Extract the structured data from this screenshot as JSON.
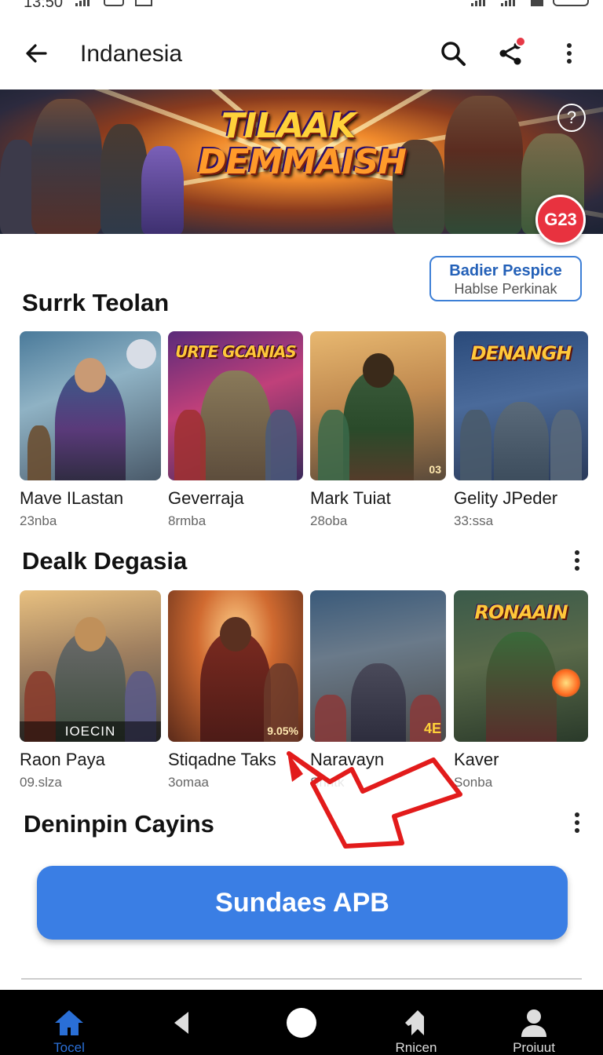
{
  "status": {
    "time": "13:50"
  },
  "appbar": {
    "title": "Indanesia",
    "search_icon": "search-icon",
    "share_icon": "share-icon",
    "more_icon": "more-vert-icon"
  },
  "banner": {
    "logo_line1": "TILAAK",
    "logo_line2": "DEMMAISH",
    "help_label": "?",
    "badge_label": "G23"
  },
  "promo": {
    "line1": "Badier Pespice",
    "line2": "Hablse Perkinak"
  },
  "sections": [
    {
      "title": "Surrk Teolan",
      "items": [
        {
          "name": "Mave ILastan",
          "meta": "23nba"
        },
        {
          "name": "Geverraja",
          "meta": "8rmba",
          "art_title": "URTE GCANIAS"
        },
        {
          "name": "Mark Tuiat",
          "meta": "28oba",
          "corner": "03"
        },
        {
          "name": "Gelity JPeder",
          "meta": "33:ssa",
          "art_title": "DENANGH"
        }
      ]
    },
    {
      "title": "Dealk Degasia",
      "items": [
        {
          "name": "Raon Paya",
          "meta": "09.slza",
          "footer": "IOECIN"
        },
        {
          "name": "Stiqadne Taks",
          "meta": "3omaa",
          "corner": "9.05%"
        },
        {
          "name": "Naravayn",
          "meta": "Shntk",
          "corner": "4E"
        },
        {
          "name": "Kaver",
          "meta": "Sonba",
          "art_title": "RONAAIN"
        }
      ]
    },
    {
      "title": "Deninpin Cayins"
    }
  ],
  "cta": {
    "label": "Sundaes APB"
  },
  "nav": [
    {
      "label": "Tocel",
      "icon": "home-icon",
      "active": true
    },
    {
      "label": "",
      "icon": "back-triangle-icon"
    },
    {
      "label": "",
      "icon": "home-circle-icon"
    },
    {
      "label": "Rnicen",
      "icon": "bookmark-icon"
    },
    {
      "label": "Proiuut",
      "icon": "profile-icon"
    }
  ],
  "colors": {
    "accent": "#3a7ee4",
    "badge": "#e8323f",
    "annotation_arrow": "#e21b1b"
  }
}
